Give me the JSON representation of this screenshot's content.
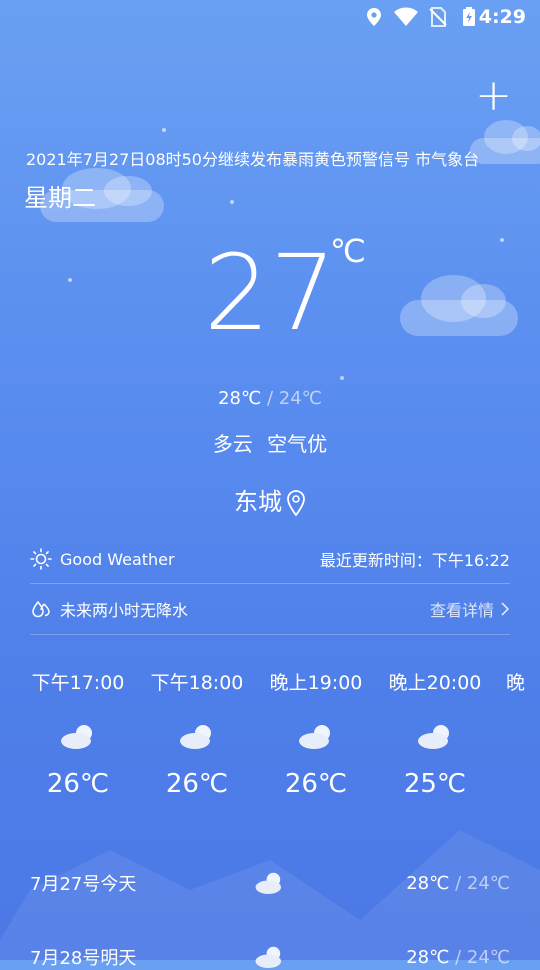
{
  "status_bar": {
    "time": "4:29"
  },
  "header": {
    "add_label": "+",
    "ticker": "2021年7月27日08时50分继续发布暴雨黄色预警信号  市气象台",
    "weekday": "星期二"
  },
  "current": {
    "temp": "27",
    "unit": "℃",
    "high": "28℃",
    "sep": " / ",
    "low": "24℃",
    "condition": "多云",
    "air": "空气优",
    "city": "东城"
  },
  "info_row": {
    "status": "Good Weather",
    "update": "最近更新时间：下午16:22"
  },
  "rain_row": {
    "text": "未来两小时无降水",
    "link": "查看详情"
  },
  "hourly": [
    {
      "time": "下午17:00",
      "temp": "26℃",
      "icon": "cloudy-icon"
    },
    {
      "time": "下午18:00",
      "temp": "26℃",
      "icon": "cloudy-icon"
    },
    {
      "time": "晚上19:00",
      "temp": "26℃",
      "icon": "cloudy-icon"
    },
    {
      "time": "晚上20:00",
      "temp": "25℃",
      "icon": "cloudy-icon"
    },
    {
      "time": "晚"
    }
  ],
  "daily": [
    {
      "date": "7月27号今天",
      "high": "28℃",
      "sep": " / ",
      "low": "24℃",
      "icon": "cloudy-icon"
    },
    {
      "date": "7月28号明天",
      "high": "28℃",
      "sep": " / ",
      "low": "24℃",
      "icon": "cloudy-icon"
    }
  ]
}
